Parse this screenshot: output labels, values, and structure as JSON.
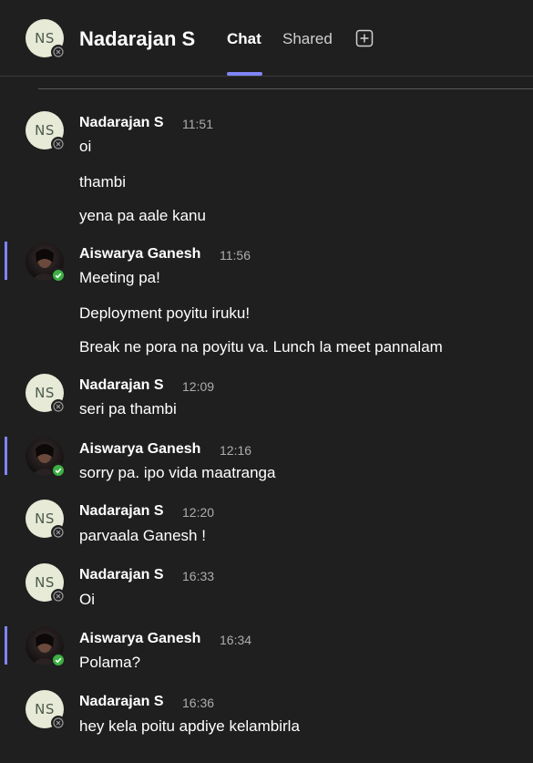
{
  "header": {
    "avatar_initials": "NS",
    "title": "Nadarajan S",
    "tabs": [
      {
        "label": "Chat",
        "selected": true
      },
      {
        "label": "Shared",
        "selected": false
      }
    ],
    "add_tab_icon": "plus-square-icon"
  },
  "colors": {
    "accent": "#7f85f5",
    "online": "#3cb043",
    "avatar_bg": "#e6ead6"
  },
  "messages": [
    {
      "sender": "Nadarajan S",
      "initials": "NS",
      "time": "11:51",
      "status": "offline",
      "lines": [
        "oi",
        "thambi",
        "yena pa aale kanu"
      ]
    },
    {
      "sender": "Aiswarya Ganesh",
      "time": "11:56",
      "status": "online",
      "lines": [
        "Meeting pa!",
        "Deployment poyitu iruku!",
        "Break ne pora na poyitu va. Lunch la meet pannalam"
      ]
    },
    {
      "sender": "Nadarajan S",
      "initials": "NS",
      "time": "12:09",
      "status": "offline",
      "lines": [
        "seri pa thambi"
      ]
    },
    {
      "sender": "Aiswarya Ganesh",
      "time": "12:16",
      "status": "online",
      "lines": [
        "sorry pa. ipo vida maatranga"
      ]
    },
    {
      "sender": "Nadarajan S",
      "initials": "NS",
      "time": "12:20",
      "status": "offline",
      "lines": [
        "parvaala Ganesh !"
      ]
    },
    {
      "sender": "Nadarajan S",
      "initials": "NS",
      "time": "16:33",
      "status": "offline",
      "lines": [
        "Oi"
      ]
    },
    {
      "sender": "Aiswarya Ganesh",
      "time": "16:34",
      "status": "online",
      "lines": [
        "Polama?"
      ]
    },
    {
      "sender": "Nadarajan S",
      "initials": "NS",
      "time": "16:36",
      "status": "offline",
      "lines": [
        "hey kela poitu apdiye kelambirla"
      ]
    }
  ]
}
